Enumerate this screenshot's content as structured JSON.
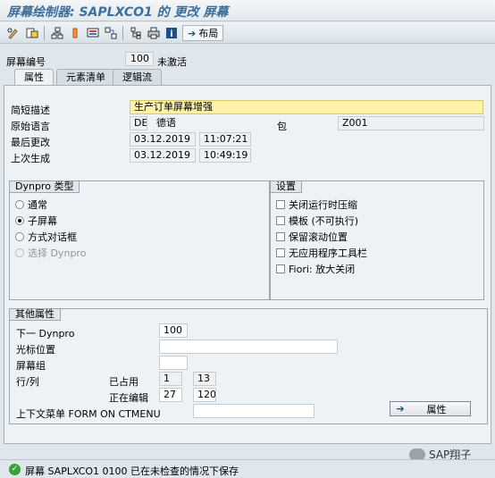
{
  "window": {
    "title": "屏幕绘制器: SAPLXCO1 的 更改 屏幕"
  },
  "toolbar": {
    "icons": [
      "pencil-glasses-icon",
      "object-icon",
      "hierarchy-icon",
      "light-icon",
      "screen-icon",
      "network-icon",
      "tree-icon",
      "print-icon",
      "info-icon"
    ],
    "layout_label": "布局"
  },
  "screen_header": {
    "label": "屏幕编号",
    "value": "100",
    "status": "未激活"
  },
  "tabs": [
    {
      "label": "属性",
      "active": true
    },
    {
      "label": "元素清单",
      "active": false
    },
    {
      "label": "逻辑流",
      "active": false
    }
  ],
  "attributes": {
    "short_desc_label": "简短描述",
    "short_desc_value": "生产订单屏幕增强",
    "orig_lang_label": "原始语言",
    "orig_lang_code": "DE",
    "orig_lang_name": "德语",
    "package_label": "包",
    "package_value": "Z001",
    "last_changed_label": "最后更改",
    "last_changed_date": "03.12.2019",
    "last_changed_time": "11:07:21",
    "last_generated_label": "上次生成",
    "last_generated_date": "03.12.2019",
    "last_generated_time": "10:49:19"
  },
  "dynpro_type": {
    "title": "Dynpro 类型",
    "options": [
      {
        "label": "通常",
        "selected": false,
        "disabled": false
      },
      {
        "label": "子屏幕",
        "selected": true,
        "disabled": false
      },
      {
        "label": "方式对话框",
        "selected": false,
        "disabled": false
      },
      {
        "label": "选择 Dynpro",
        "selected": false,
        "disabled": true
      }
    ]
  },
  "settings": {
    "title": "设置",
    "options": [
      {
        "label": "关闭运行时压缩",
        "checked": false
      },
      {
        "label": "模板 (不可执行)",
        "checked": false
      },
      {
        "label": "保留滚动位置",
        "checked": false
      },
      {
        "label": "无应用程序工具栏",
        "checked": false
      },
      {
        "label": "Fiori: 放大关闭",
        "checked": false
      }
    ]
  },
  "other_attrs": {
    "title": "其他属性",
    "next_dynpro_label": "下一 Dynpro",
    "next_dynpro_value": "100",
    "cursor_pos_label": "光标位置",
    "cursor_pos_value": "",
    "screen_group_label": "屏幕组",
    "screen_group_value": "",
    "row_col_label": "行/列",
    "used_label": "已占用",
    "used_row": "1",
    "used_col": "13",
    "editing_label": "正在编辑",
    "editing_row": "27",
    "editing_col": "120",
    "context_menu_label": "上下文菜单 FORM ON CTMENU",
    "context_menu_value": "",
    "properties_button": "属性"
  },
  "status_bar": {
    "message": "屏幕 SAPLXCO1 0100 已在未检查的情况下保存",
    "type": "success"
  },
  "watermark": {
    "text": "SAP翔子"
  }
}
